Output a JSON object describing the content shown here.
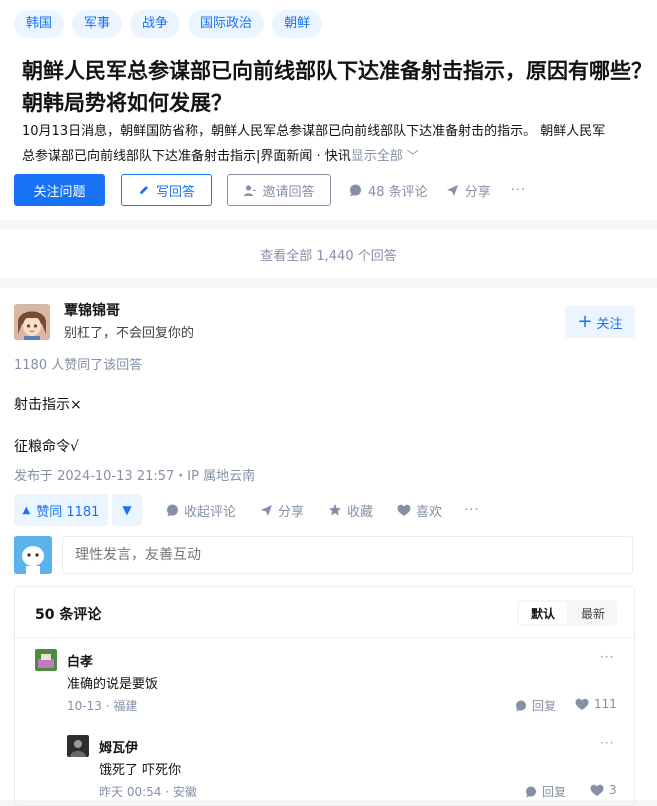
{
  "tags": [
    "韩国",
    "军事",
    "战争",
    "国际政治",
    "朝鲜"
  ],
  "question": {
    "title": "朝鲜人民军总参谋部已向前线部队下达准备射击指示，原因有哪些？朝韩局势将如何发展？",
    "detail_line1": "10月13日消息，朝鲜国防省称，朝鲜人民军总参谋部已向前线部队下达准备射击的指示。 朝鲜人民军",
    "detail_line2": "总参谋部已向前线部队下达准备射击指示|界面新闻 · 快讯",
    "show_all": "显示全部",
    "follow_label": "关注问题",
    "write_label": "写回答",
    "invite_label": "邀请回答",
    "comments_label": "48 条评论",
    "share_label": "分享",
    "more_label": "···"
  },
  "view_all": "查看全部 1,440 个回答",
  "answer": {
    "author_name": "覃锦锦哥",
    "author_bio": "别杠了，不会回复你的",
    "follow_label": "关注",
    "votes_text": "1180 人赞同了该回答",
    "content": [
      "射击指示×",
      "征粮命令√"
    ],
    "meta": "发布于 2024-10-13 21:57・IP 属地云南",
    "vote_label": "赞同 1181",
    "collapse_comments": "收起评论",
    "share_label": "分享",
    "favorite_label": "收藏",
    "like_label": "喜欢",
    "more_label": "···",
    "comment_placeholder": "理性发言，友善互动"
  },
  "comments": {
    "count_label": "50 条评论",
    "sort_default": "默认",
    "sort_latest": "最新",
    "items": [
      {
        "name": "白孝",
        "text": "准确的说是要饭",
        "time": "10-13",
        "location": "福建",
        "reply": "回复",
        "likes": "111",
        "more": "···"
      },
      {
        "name": "姆瓦伊",
        "text": "饿死了 吓死你",
        "time": "昨天 00:54",
        "location": "安徽",
        "reply": "回复",
        "likes": "3",
        "more": "···"
      }
    ]
  },
  "colors": {
    "accent": "#1772f6",
    "accent_light": "#ebf5ff",
    "muted": "#8590a6"
  }
}
